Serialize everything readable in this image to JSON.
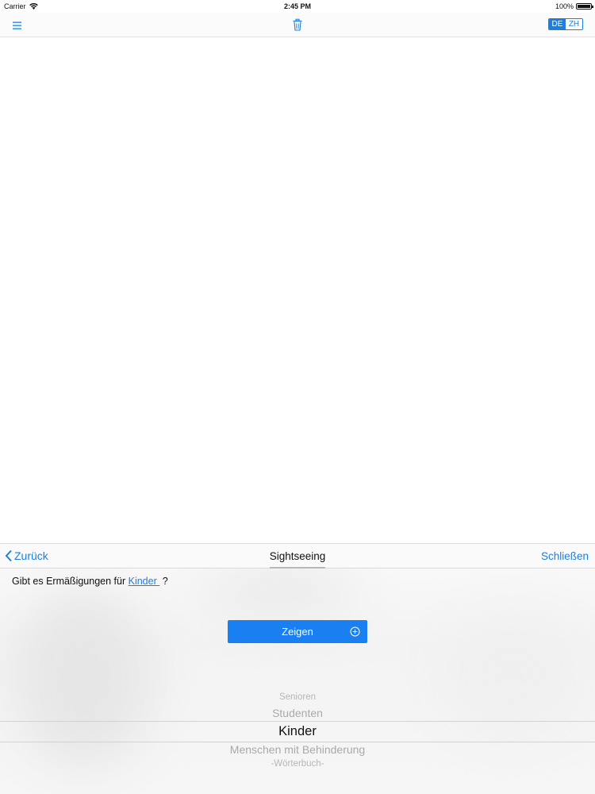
{
  "status_bar": {
    "carrier": "Carrier",
    "time": "2:45 PM",
    "battery": "100%"
  },
  "toolbar": {
    "menu_icon": "hamburger-icon",
    "trash_icon": "trash-icon",
    "languages": [
      {
        "label": "DE",
        "active": true
      },
      {
        "label": "ZH",
        "active": false
      }
    ],
    "accent_color": "#1c7fe0"
  },
  "panel": {
    "back_label": "Zurück",
    "title": "Sightseeing",
    "close_label": "Schließen",
    "question": {
      "before": "Gibt es Ermäßigungen für ",
      "link": "Kinder ",
      "after": " ?"
    },
    "show_button": {
      "label": "Zeigen",
      "color": "#1a7ff0"
    },
    "picker": {
      "items": [
        "Senioren",
        "Studenten",
        "Kinder",
        "Menschen mit Behinderung",
        "-Wörterbuch-"
      ],
      "selected": "Kinder"
    }
  }
}
